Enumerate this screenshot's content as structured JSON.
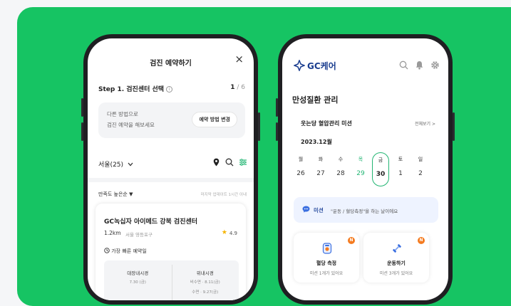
{
  "phone1": {
    "header_title": "검진 예약하기",
    "close_icon": "×",
    "step_label": "Step 1. 검진센터 선택",
    "step_current": "1",
    "step_total": "/ 6",
    "alt_line1": "다른 방법으로",
    "alt_line2": "검진 예약을 해보세요",
    "alt_button": "예약 방법 변경",
    "region_select": "서울(25)",
    "sort_label": "만족도 높은순 ▼",
    "updated_label": "마지막 업데이트 1시간 이내",
    "center": {
      "name": "GC녹십자 아이메드 강북 검진센터",
      "distance": "1.2km",
      "address": "서울 영등포구",
      "rating": "4.9",
      "fastest_label": "가장 빠른 예약일",
      "col1_header": "대장내시경",
      "col1_value": "7.30 (금)",
      "col2_header": "위내시경",
      "col2_value1": "비수면 · 8.11(금)",
      "col2_value2": "수면 · 9.27(금)"
    }
  },
  "phone2": {
    "logo_text": "GC케어",
    "page_title": "만성질환 관리",
    "mission_title": "웃는당 혈압관리 미션",
    "see_all": "전체보기 >",
    "month_label": "2023.12월",
    "weekdays": [
      "월",
      "화",
      "수",
      "목",
      "금",
      "토",
      "일"
    ],
    "dates": [
      "26",
      "27",
      "28",
      "29",
      "30",
      "1",
      "2"
    ],
    "active_index": 4,
    "mission_badge": "미션",
    "mission_text": "\"운동 / 혈당측정\"을 하는 날이에요",
    "tiles": [
      {
        "title": "혈당 측정",
        "subtitle": "미션 1개가 있어요",
        "badge": "N",
        "icon": "glucose-meter-icon"
      },
      {
        "title": "운동하기",
        "subtitle": "미션 3개가 있어요",
        "badge": "N",
        "icon": "dumbbell-icon"
      }
    ]
  },
  "colors": {
    "background_green": "#16c463",
    "accent_green": "#22b573",
    "brand_navy": "#1a3d8f",
    "badge_orange": "#f47b20"
  }
}
